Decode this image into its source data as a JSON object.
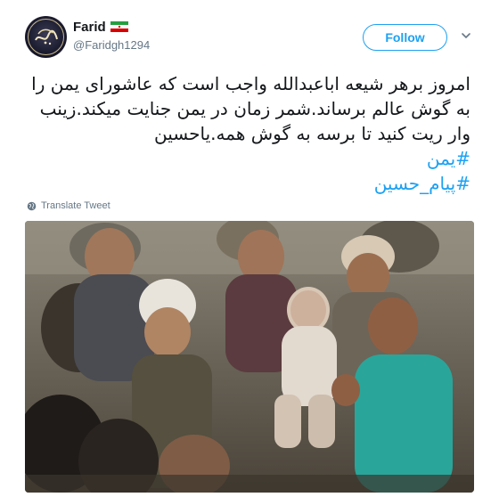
{
  "author": {
    "display_name": "Farid",
    "handle": "@Faridgh1294",
    "avatar_icon": "calligraphy-avatar-icon",
    "flag_icon": "iran-flag-icon"
  },
  "actions": {
    "follow_label": "Follow",
    "menu_icon": "chevron-down-icon"
  },
  "tweet": {
    "lines": [
      "امروز برهر شیعه اباعبدالله واجب است که عاشورای یمن را",
      "به گوش عالم برساند.شمر زمان در یمن جنایت میکند.زینب",
      "وار ریت کنید تا برسه به گوش همه.یاحسین"
    ],
    "hashtags": [
      "#یمن",
      "#پیام_حسین"
    ],
    "translate_label": "Translate Tweet"
  },
  "media": {
    "type": "photo",
    "icon": "rescue-photo"
  },
  "colors": {
    "link": "#1da1f2",
    "text": "#14171a",
    "muted": "#657786"
  }
}
